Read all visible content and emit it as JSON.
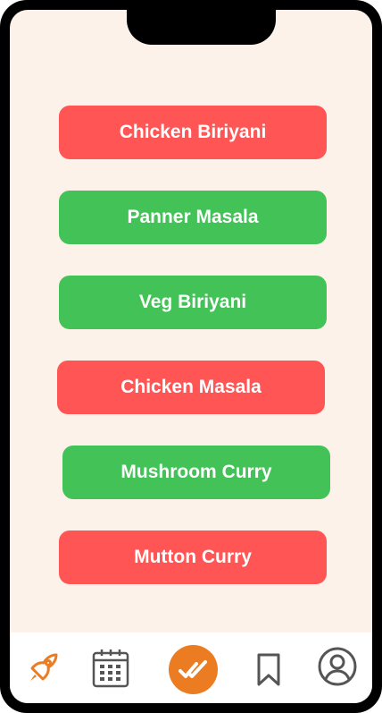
{
  "dishes": [
    {
      "label": "Chicken Biriyani",
      "status": "red"
    },
    {
      "label": "Panner Masala",
      "status": "green"
    },
    {
      "label": "Veg Biriyani",
      "status": "green"
    },
    {
      "label": "Chicken Masala",
      "status": "red"
    },
    {
      "label": "Mushroom Curry",
      "status": "green"
    },
    {
      "label": "Mutton Curry",
      "status": "red"
    }
  ],
  "colors": {
    "background": "#fcf2ea",
    "red": "#ff5555",
    "green": "#42c257",
    "accent": "#ec7c22",
    "icon_dark": "#555555"
  },
  "nav": {
    "items": [
      {
        "icon": "rocket-icon"
      },
      {
        "icon": "calendar-icon"
      },
      {
        "icon": "double-check-icon",
        "active": true
      },
      {
        "icon": "bookmark-icon"
      },
      {
        "icon": "user-icon"
      }
    ]
  }
}
